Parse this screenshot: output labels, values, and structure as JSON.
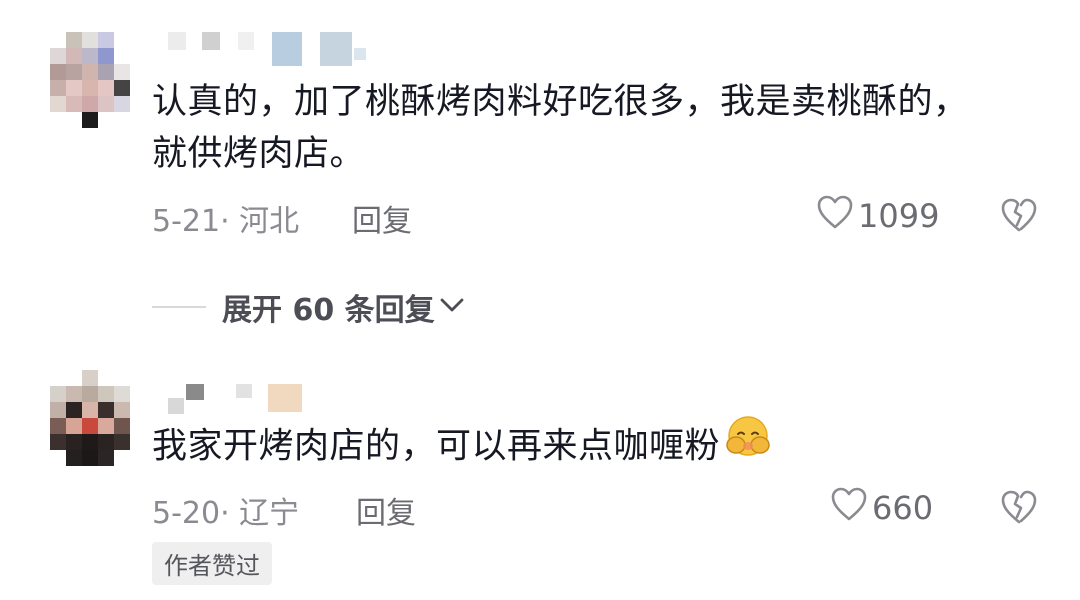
{
  "comments": [
    {
      "text_line1": "认真的，加了桃酥烤肉料好吃很多，我是卖桃酥的，",
      "text_line2": "就供烤肉店。",
      "date_location": "5-21· 河北",
      "reply_label": "回复",
      "like_count": "1099",
      "like_icon": "heart-outline-icon",
      "dislike_icon": "broken-heart-icon"
    },
    {
      "text": "我家开烤肉店的，可以再来点咖喱粉",
      "emoji": "face-with-hands-covering-emoji",
      "date_location": "5-20· 辽宁",
      "reply_label": "回复",
      "like_count": "660",
      "like_icon": "heart-outline-icon",
      "dislike_icon": "broken-heart-icon",
      "badge": "作者赞过"
    }
  ],
  "expand_replies": {
    "label": "展开 60 条回复",
    "icon": "chevron-down-icon"
  },
  "colors": {
    "text_primary": "#161823",
    "text_secondary": "#8a8b91",
    "badge_bg": "#efefef"
  }
}
